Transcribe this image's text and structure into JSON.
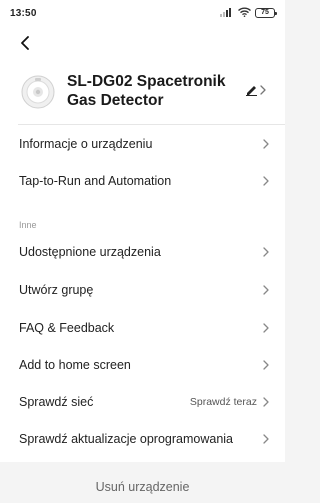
{
  "status_bar": {
    "time": "13:50",
    "battery": "75",
    "icons": [
      "signal-icon",
      "wifi-icon",
      "battery-icon"
    ]
  },
  "header": {
    "back_icon": "back-arrow-icon",
    "device_name": "SL-DG02 Spacetronik Gas Detector",
    "edit_icon": "pencil-icon"
  },
  "top_menu": [
    {
      "label": "Informacje o urządzeniu"
    },
    {
      "label": "Tap-to-Run and Automation"
    }
  ],
  "other_section": {
    "title": "Inne",
    "items": [
      {
        "label": "Udostępnione urządzenia"
      },
      {
        "label": "Utwórz grupę"
      },
      {
        "label": "FAQ & Feedback"
      },
      {
        "label": "Add to home screen"
      },
      {
        "label": "Sprawdź sieć",
        "value": "Sprawdź teraz"
      },
      {
        "label": "Sprawdź aktualizacje oprogramowania"
      }
    ]
  },
  "remove_button": {
    "label": "Usuń urządzenie"
  },
  "colors": {
    "background": "#f4f4f4",
    "panel": "#ffffff",
    "text": "#222222",
    "muted": "#999999"
  }
}
